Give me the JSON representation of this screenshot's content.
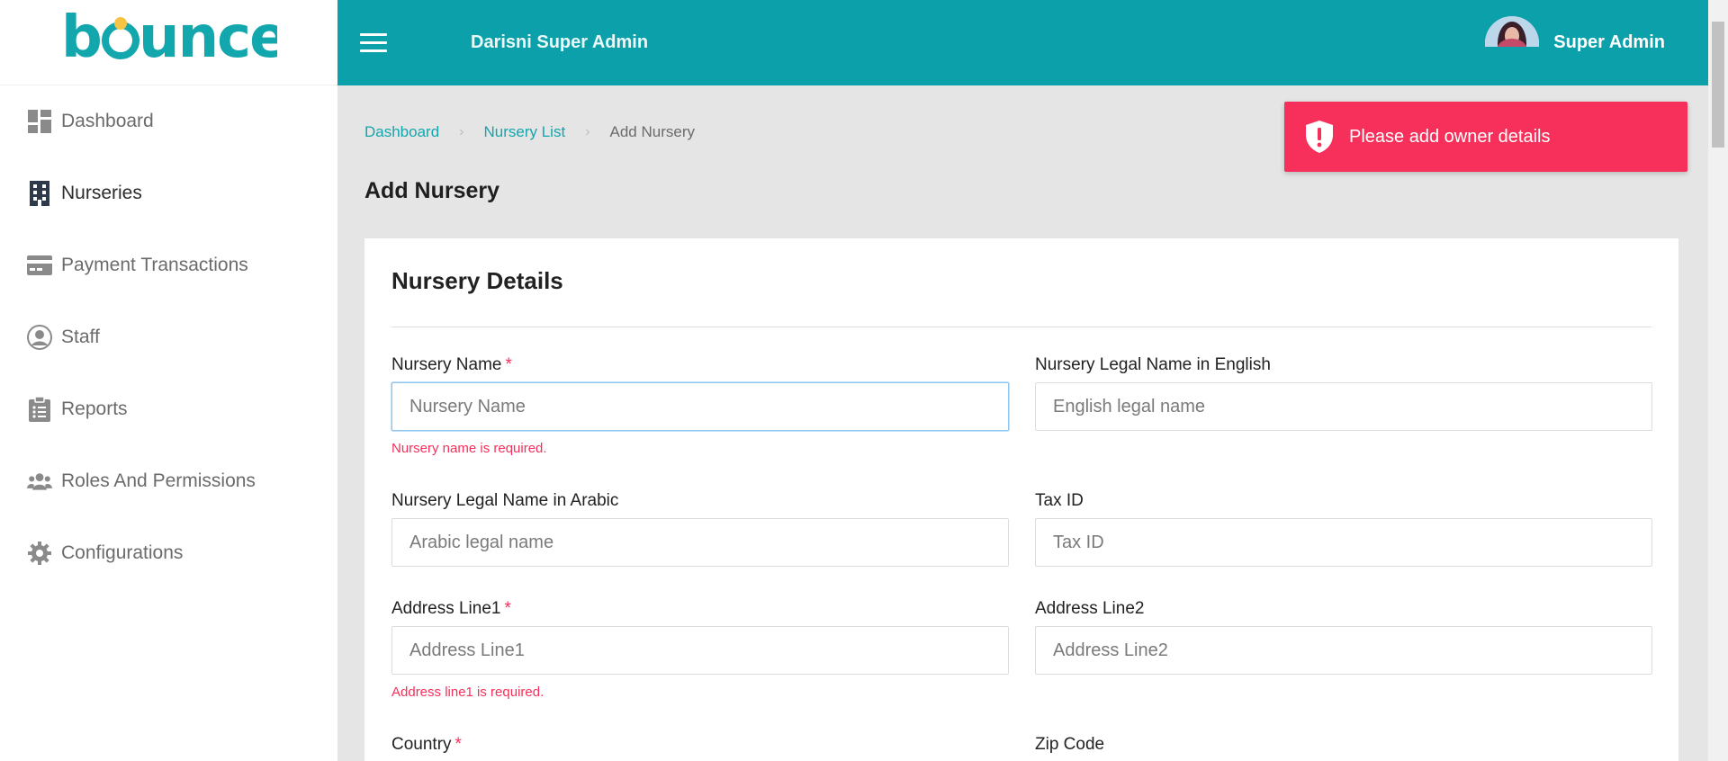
{
  "sidebar": {
    "logo": "bounce",
    "items": [
      {
        "label": "Dashboard",
        "icon": "dashboard-icon"
      },
      {
        "label": "Nurseries",
        "icon": "building-icon"
      },
      {
        "label": "Payment Transactions",
        "icon": "credit-card-icon"
      },
      {
        "label": "Staff",
        "icon": "user-circle-icon"
      },
      {
        "label": "Reports",
        "icon": "clipboard-list-icon"
      },
      {
        "label": "Roles And Permissions",
        "icon": "users-group-icon"
      },
      {
        "label": "Configurations",
        "icon": "gear-icon"
      }
    ]
  },
  "header": {
    "title": "Darisni Super Admin",
    "user_name": "Super Admin"
  },
  "breadcrumb": {
    "items": [
      "Dashboard",
      "Nursery List",
      "Add Nursery"
    ]
  },
  "page": {
    "title": "Add Nursery"
  },
  "toast": {
    "message": "Please add owner details",
    "color": "#f6305a"
  },
  "form": {
    "section_title": "Nursery Details",
    "fields": [
      {
        "label": "Nursery Name",
        "required": "*",
        "placeholder": "Nursery Name",
        "error": "Nursery name is required."
      },
      {
        "label": "Nursery Legal Name in English",
        "placeholder": "English legal name"
      },
      {
        "label": "Nursery Legal Name in Arabic",
        "placeholder": "Arabic legal name"
      },
      {
        "label": "Tax ID",
        "placeholder": "Tax ID"
      },
      {
        "label": "Address Line1",
        "required": "*",
        "placeholder": "Address Line1",
        "error": "Address line1 is required."
      },
      {
        "label": "Address Line2",
        "placeholder": "Address Line2"
      },
      {
        "label": "Country",
        "required": "*"
      },
      {
        "label": "Zip Code"
      }
    ]
  },
  "colors": {
    "brand": "#0ca1aa",
    "error": "#f6305a"
  }
}
